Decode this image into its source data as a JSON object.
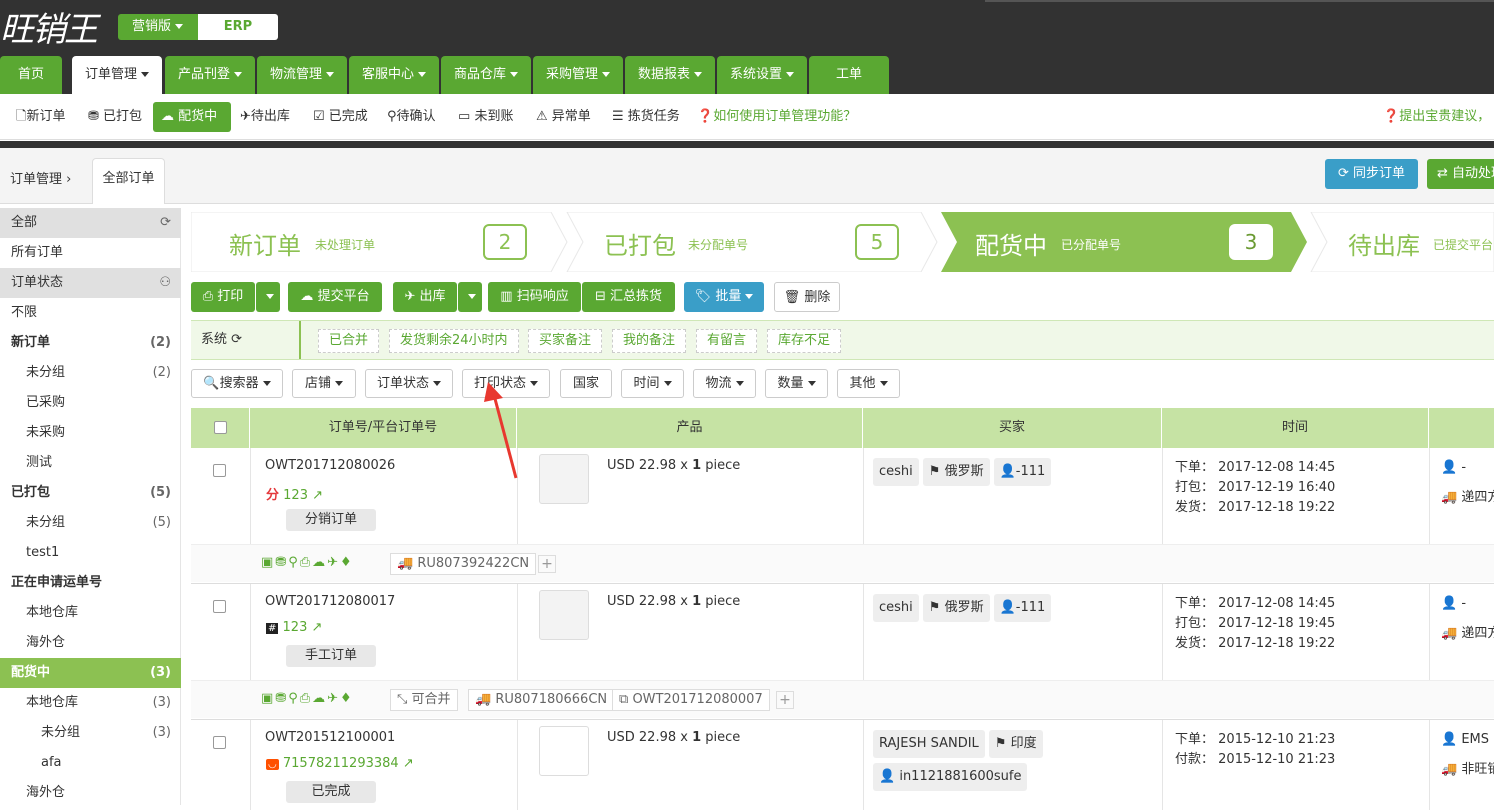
{
  "header": {
    "logo": "旺销王",
    "mode": "营销版",
    "erp": "ERP",
    "nav": [
      "首页",
      "订单管理",
      "产品刊登",
      "物流管理",
      "客服中心",
      "商品仓库",
      "采购管理",
      "数据报表",
      "系统设置",
      "工单"
    ]
  },
  "subnav": {
    "items": [
      "新订单",
      "已打包",
      "配货中",
      "待出库",
      "已完成",
      "待确认",
      "未到账",
      "异常单",
      "拣货任务"
    ],
    "help": "如何使用订单管理功能？",
    "suggest": "提出宝贵建议，",
    "icons": [
      "file-icon",
      "gift-icon",
      "cloud-upload-icon",
      "plane-icon",
      "check-square-icon",
      "pin-icon",
      "credit-card-icon",
      "warning-icon",
      "list-icon"
    ]
  },
  "crumb": {
    "root": "订单管理",
    "current": "全部订单",
    "sync": "同步订单",
    "auto": "自动处理"
  },
  "sidebar": [
    {
      "label": "全部",
      "type": "hd"
    },
    {
      "label": "所有订单",
      "type": "row"
    },
    {
      "label": "订单状态",
      "type": "hd"
    },
    {
      "label": "不限",
      "type": "row"
    },
    {
      "label": "新订单",
      "type": "b",
      "count": "(2)"
    },
    {
      "label": "未分组",
      "type": "l1",
      "count": "(2)"
    },
    {
      "label": "已采购",
      "type": "l1"
    },
    {
      "label": "未采购",
      "type": "l1"
    },
    {
      "label": "测试",
      "type": "l1"
    },
    {
      "label": "已打包",
      "type": "b",
      "count": "(5)"
    },
    {
      "label": "未分组",
      "type": "l1",
      "count": "(5)"
    },
    {
      "label": "test1",
      "type": "l1"
    },
    {
      "label": "正在申请运单号",
      "type": "b"
    },
    {
      "label": "本地仓库",
      "type": "l1"
    },
    {
      "label": "海外仓",
      "type": "l1"
    },
    {
      "label": "配货中",
      "type": "act",
      "count": "(3)"
    },
    {
      "label": "本地仓库",
      "type": "l1",
      "count": "(3)"
    },
    {
      "label": "未分组",
      "type": "l2",
      "count": "(3)"
    },
    {
      "label": "afa",
      "type": "l2"
    },
    {
      "label": "海外仓",
      "type": "l1"
    }
  ],
  "steps": [
    {
      "title": "新订单",
      "sub": "未处理订单",
      "count": "2"
    },
    {
      "title": "已打包",
      "sub": "未分配单号",
      "count": "5"
    },
    {
      "title": "配货中",
      "sub": "已分配单号",
      "count": "3"
    },
    {
      "title": "待出库",
      "sub": "已提交平台",
      "count": ""
    }
  ],
  "toolbar": {
    "print": "打印",
    "submit": "提交平台",
    "out": "出库",
    "scan": "扫码响应",
    "collect": "汇总拣货",
    "batch": "批量",
    "delete": "删除"
  },
  "filter": {
    "system": "系统",
    "tags": [
      "已合并",
      "发货剩余24小时内",
      "买家备注",
      "我的备注",
      "有留言",
      "库存不足"
    ],
    "dropdowns": [
      "搜索器",
      "店铺",
      "订单状态",
      "打印状态",
      "国家",
      "时间",
      "物流",
      "数量",
      "其他"
    ]
  },
  "table": {
    "headers": [
      "订单号/平台订单号",
      "产品",
      "买家",
      "时间"
    ],
    "orders": [
      {
        "id": "OWT201712080026",
        "platform_no": "123",
        "label": "分销订单",
        "product": "USD 22.98 x ",
        "qty": "1",
        "unit": " piece",
        "buyer": "ceshi",
        "country": "俄罗斯",
        "num": "-111",
        "t1k": "下单：",
        "t1": "2017-12-08 14:45",
        "t2k": "打包：",
        "t2": "2017-12-19 16:40",
        "t3k": "发货：",
        "t3": "2017-12-18 19:22",
        "r1": "-",
        "r2": "递四方",
        "track": "RU807392422CN"
      },
      {
        "id": "OWT201712080017",
        "platform_no": "123",
        "label": "手工订单",
        "product": "USD 22.98 x ",
        "qty": "1",
        "unit": " piece",
        "buyer": "ceshi",
        "country": "俄罗斯",
        "num": "-111",
        "t1k": "下单：",
        "t1": "2017-12-08 14:45",
        "t2k": "打包：",
        "t2": "2017-12-18 19:45",
        "t3k": "发货：",
        "t3": "2017-12-18 19:22",
        "r1": "-",
        "r2": "递四方",
        "merge": "可合并",
        "track": "RU807180666CN",
        "ref": "OWT201712080007"
      },
      {
        "id": "OWT201512100001",
        "platform_no": "71578211293384",
        "label": "已完成",
        "product": "USD 22.98 x ",
        "qty": "1",
        "unit": " piece",
        "buyer": "RAJESH SANDIL",
        "country": "印度",
        "user": "in1121881600sufe",
        "t1k": "下单：",
        "t1": "2015-12-10 21:23",
        "t2k": "付款：",
        "t2": "2015-12-10 21:23",
        "r1": "EMS",
        "r2": "非旺销"
      }
    ]
  }
}
